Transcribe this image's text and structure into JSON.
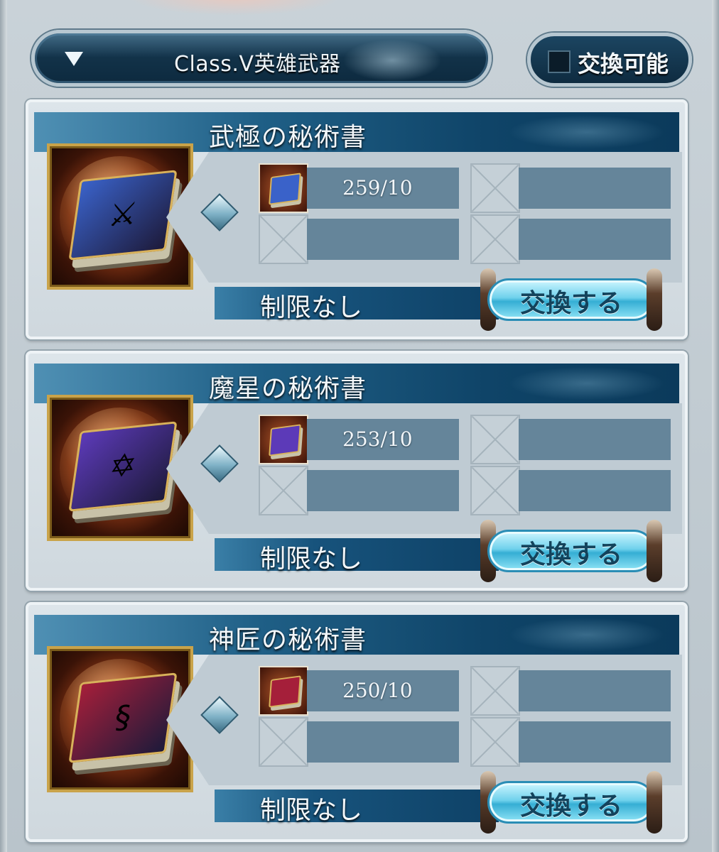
{
  "header": {
    "filter_label": "Class.Ⅴ英雄武器",
    "exchangeable_label": "交換可能",
    "exchangeable_checked": false
  },
  "cards": [
    {
      "title": "武極の秘術書",
      "item_icon": "blue-book-sword-icon",
      "book_color": "#3a62c9",
      "emblem": "⚔",
      "material_count": "259/10",
      "limit_label": "制限なし",
      "button_label": "交換する"
    },
    {
      "title": "魔星の秘術書",
      "item_icon": "purple-book-star-icon",
      "book_color": "#5c3ab8",
      "emblem": "✡",
      "material_count": "253/10",
      "limit_label": "制限なし",
      "button_label": "交換する"
    },
    {
      "title": "神匠の秘術書",
      "item_icon": "red-book-ornament-icon",
      "book_color": "#a51f3a",
      "emblem": "§",
      "material_count": "250/10",
      "limit_label": "制限なし",
      "button_label": "交換する"
    }
  ],
  "colors": {
    "header_navy": "#0d2a3f",
    "button_cyan": "#6fd1ec",
    "bar_steel": "#65859a"
  }
}
